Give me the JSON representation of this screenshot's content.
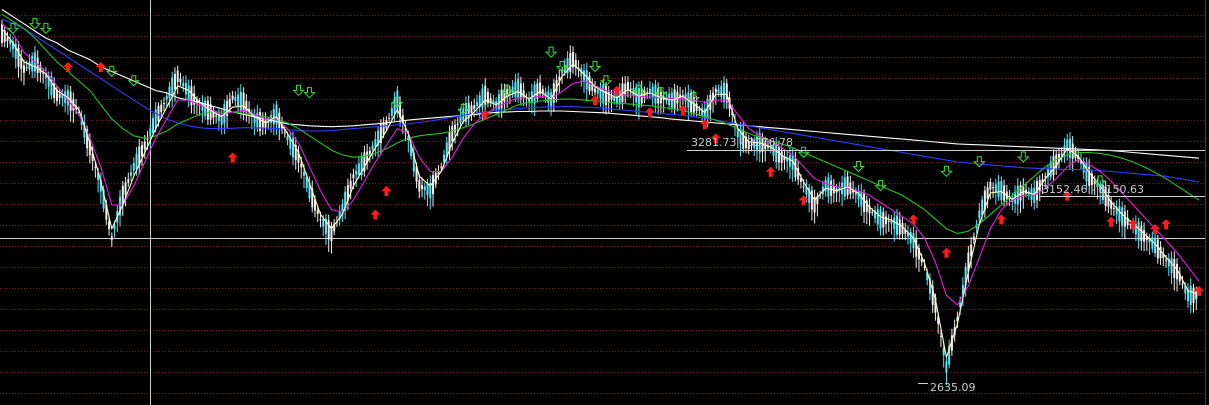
{
  "chart_data": {
    "type": "line",
    "title": "",
    "xlabel": "",
    "ylabel": "",
    "grid": true,
    "ylim": [
      2600,
      3450
    ],
    "annotations": [
      {
        "text": "3281.73 - 3276.78",
        "value": 3281.73
      },
      {
        "text": "3152.46 - 3150.63",
        "value": 3152.46
      },
      {
        "text": "2635.09",
        "value": 2635.09
      }
    ],
    "series": [
      {
        "style": "candlestick",
        "color": "#5fe3f5",
        "values": [
          3380,
          3355,
          3305,
          3320,
          3290,
          3250,
          3245,
          3215,
          3140,
          3060,
          2950,
          3040,
          3100,
          3145,
          3200,
          3245,
          3290,
          3255,
          3230,
          3215,
          3200,
          3245,
          3235,
          3200,
          3190,
          3210,
          3160,
          3120,
          3050,
          2990,
          2960,
          3010,
          3080,
          3110,
          3150,
          3190,
          3240,
          3160,
          3060,
          3050,
          3100,
          3170,
          3210,
          3225,
          3250,
          3230,
          3255,
          3265,
          3240,
          3265,
          3240,
          3300,
          3325,
          3290,
          3260,
          3250,
          3240,
          3270,
          3245,
          3260,
          3245,
          3240,
          3250,
          3230,
          3210,
          3260,
          3255,
          3170,
          3145,
          3150,
          3140,
          3120,
          3110,
          3060,
          3020,
          3060,
          3050,
          3060,
          3040,
          3010,
          2990,
          2985,
          2970,
          2945,
          2890,
          2810,
          2680,
          2780,
          2900,
          3000,
          3060,
          3050,
          3030,
          3050,
          3040,
          3080,
          3110,
          3145,
          3120,
          3080,
          3055,
          3020,
          2995,
          2975,
          2955,
          2935,
          2905,
          2880,
          2830,
          2830
        ]
      },
      {
        "style": "line",
        "color": "#ffffff",
        "values": [
          3430,
          3415,
          3400,
          3385,
          3370,
          3360,
          3345,
          3335,
          3325,
          3310,
          3300,
          3290,
          3280,
          3270,
          3260,
          3255,
          3245,
          3240,
          3235,
          3228,
          3222,
          3215,
          3210,
          3205,
          3200,
          3195,
          3190,
          3188,
          3186,
          3185,
          3184,
          3185,
          3186,
          3188,
          3190,
          3192,
          3195,
          3198,
          3200,
          3202,
          3204,
          3206,
          3208,
          3210,
          3212,
          3214,
          3215,
          3216,
          3216,
          3217,
          3217,
          3217,
          3216,
          3215,
          3214,
          3213,
          3211,
          3209,
          3207,
          3205,
          3203,
          3200,
          3198,
          3196,
          3194,
          3192,
          3190,
          3188,
          3186,
          3184,
          3182,
          3180,
          3178,
          3176,
          3174,
          3172,
          3170,
          3168,
          3166,
          3164,
          3162,
          3160,
          3158,
          3156,
          3154,
          3152,
          3150,
          3148,
          3147,
          3146,
          3145,
          3144,
          3143,
          3142,
          3141,
          3140,
          3139,
          3138,
          3137,
          3136,
          3135,
          3134,
          3132,
          3130,
          3128,
          3126,
          3124,
          3122,
          3120,
          3118
        ]
      },
      {
        "style": "line",
        "color": "#2f3cff",
        "values": [
          3410,
          3400,
          3390,
          3375,
          3360,
          3345,
          3330,
          3315,
          3300,
          3285,
          3270,
          3255,
          3240,
          3225,
          3212,
          3200,
          3192,
          3186,
          3182,
          3180,
          3180,
          3181,
          3182,
          3182,
          3181,
          3180,
          3178,
          3176,
          3175,
          3175,
          3176,
          3178,
          3180,
          3182,
          3184,
          3186,
          3188,
          3190,
          3193,
          3196,
          3200,
          3204,
          3208,
          3212,
          3215,
          3218,
          3220,
          3222,
          3224,
          3225,
          3226,
          3226,
          3226,
          3225,
          3224,
          3222,
          3220,
          3218,
          3216,
          3214,
          3212,
          3210,
          3208,
          3205,
          3202,
          3198,
          3194,
          3190,
          3186,
          3182,
          3178,
          3174,
          3170,
          3166,
          3162,
          3158,
          3154,
          3150,
          3146,
          3142,
          3138,
          3134,
          3130,
          3126,
          3122,
          3118,
          3114,
          3110,
          3108,
          3106,
          3104,
          3102,
          3100,
          3098,
          3097,
          3096,
          3095,
          3094,
          3094,
          3093,
          3092,
          3090,
          3088,
          3086,
          3084,
          3082,
          3080,
          3076,
          3072,
          3068
        ]
      },
      {
        "style": "line",
        "color": "#22c322",
        "values": [
          3420,
          3405,
          3390,
          3370,
          3345,
          3320,
          3300,
          3280,
          3260,
          3230,
          3200,
          3180,
          3165,
          3160,
          3165,
          3175,
          3190,
          3200,
          3210,
          3215,
          3215,
          3215,
          3212,
          3208,
          3205,
          3200,
          3192,
          3180,
          3165,
          3150,
          3135,
          3125,
          3120,
          3122,
          3128,
          3138,
          3150,
          3160,
          3165,
          3168,
          3170,
          3175,
          3182,
          3190,
          3200,
          3210,
          3220,
          3230,
          3235,
          3238,
          3240,
          3242,
          3242,
          3240,
          3238,
          3236,
          3234,
          3232,
          3230,
          3228,
          3225,
          3222,
          3218,
          3212,
          3205,
          3198,
          3190,
          3180,
          3170,
          3162,
          3155,
          3148,
          3140,
          3130,
          3120,
          3110,
          3100,
          3090,
          3080,
          3070,
          3060,
          3050,
          3040,
          3025,
          3010,
          2990,
          2970,
          2960,
          2965,
          2980,
          3000,
          3020,
          3040,
          3060,
          3080,
          3100,
          3115,
          3125,
          3130,
          3130,
          3128,
          3124,
          3118,
          3110,
          3100,
          3088,
          3075,
          3060,
          3045,
          3030
        ]
      },
      {
        "style": "line",
        "color": "#e020e0",
        "values": [
          3400,
          3380,
          3340,
          3320,
          3300,
          3270,
          3240,
          3210,
          3160,
          3100,
          3020,
          3020,
          3060,
          3110,
          3160,
          3200,
          3240,
          3240,
          3230,
          3220,
          3210,
          3215,
          3218,
          3210,
          3200,
          3200,
          3180,
          3150,
          3100,
          3050,
          3010,
          3005,
          3030,
          3070,
          3110,
          3145,
          3180,
          3170,
          3120,
          3090,
          3090,
          3120,
          3160,
          3190,
          3210,
          3225,
          3235,
          3245,
          3245,
          3248,
          3245,
          3258,
          3275,
          3280,
          3270,
          3260,
          3252,
          3250,
          3248,
          3246,
          3245,
          3243,
          3243,
          3240,
          3235,
          3240,
          3240,
          3210,
          3180,
          3165,
          3155,
          3140,
          3125,
          3100,
          3075,
          3065,
          3058,
          3055,
          3050,
          3040,
          3025,
          3010,
          2995,
          2980,
          2950,
          2900,
          2830,
          2810,
          2850,
          2910,
          2970,
          3010,
          3030,
          3040,
          3040,
          3055,
          3075,
          3100,
          3115,
          3105,
          3090,
          3070,
          3045,
          3020,
          2995,
          2970,
          2945,
          2920,
          2890,
          2860
        ]
      },
      {
        "style": "line",
        "color": "#ffffc8",
        "values": [
          3390,
          3360,
          3320,
          3310,
          3295,
          3260,
          3245,
          3220,
          3150,
          3070,
          2970,
          3020,
          3080,
          3130,
          3180,
          3225,
          3270,
          3260,
          3235,
          3218,
          3205,
          3225,
          3228,
          3205,
          3192,
          3205,
          3170,
          3130,
          3065,
          3000,
          2970,
          3000,
          3060,
          3100,
          3140,
          3175,
          3220,
          3170,
          3080,
          3060,
          3090,
          3150,
          3195,
          3215,
          3240,
          3230,
          3248,
          3258,
          3242,
          3258,
          3242,
          3290,
          3315,
          3295,
          3268,
          3255,
          3245,
          3262,
          3248,
          3255,
          3245,
          3240,
          3248,
          3232,
          3214,
          3252,
          3252,
          3180,
          3152,
          3150,
          3142,
          3124,
          3112,
          3068,
          3030,
          3055,
          3050,
          3058,
          3044,
          3015,
          2995,
          2988,
          2974,
          2950,
          2898,
          2822,
          2700,
          2770,
          2880,
          2980,
          3045,
          3048,
          3032,
          3048,
          3042,
          3075,
          3102,
          3138,
          3122,
          3088,
          3060,
          3026,
          3000,
          2980,
          2960,
          2938,
          2910,
          2885,
          2840,
          2832
        ]
      }
    ],
    "signals_up": [
      [
        6,
        3320
      ],
      [
        9,
        3320
      ],
      [
        21,
        3130
      ],
      [
        34,
        3010
      ],
      [
        35,
        3060
      ],
      [
        44,
        3220
      ],
      [
        54,
        3250
      ],
      [
        56,
        3270
      ],
      [
        59,
        3225
      ],
      [
        62,
        3230
      ],
      [
        64,
        3200
      ],
      [
        65,
        3170
      ],
      [
        70,
        3100
      ],
      [
        73,
        3040
      ],
      [
        83,
        3000
      ],
      [
        86,
        2930
      ],
      [
        91,
        3000
      ],
      [
        97,
        3050
      ],
      [
        101,
        2995
      ],
      [
        103,
        2990
      ],
      [
        105,
        2980
      ],
      [
        106,
        2990
      ],
      [
        109,
        2850
      ]
    ],
    "signals_down": [
      [
        1,
        3380
      ],
      [
        3,
        3390
      ],
      [
        4,
        3380
      ],
      [
        10,
        3290
      ],
      [
        12,
        3270
      ],
      [
        27,
        3250
      ],
      [
        28,
        3245
      ],
      [
        36,
        3225
      ],
      [
        42,
        3210
      ],
      [
        46,
        3250
      ],
      [
        50,
        3330
      ],
      [
        51,
        3300
      ],
      [
        54,
        3300
      ],
      [
        55,
        3270
      ],
      [
        58,
        3250
      ],
      [
        60,
        3245
      ],
      [
        63,
        3235
      ],
      [
        73,
        3120
      ],
      [
        78,
        3090
      ],
      [
        80,
        3050
      ],
      [
        86,
        3080
      ],
      [
        89,
        3100
      ],
      [
        93,
        3110
      ],
      [
        100,
        3060
      ]
    ]
  }
}
